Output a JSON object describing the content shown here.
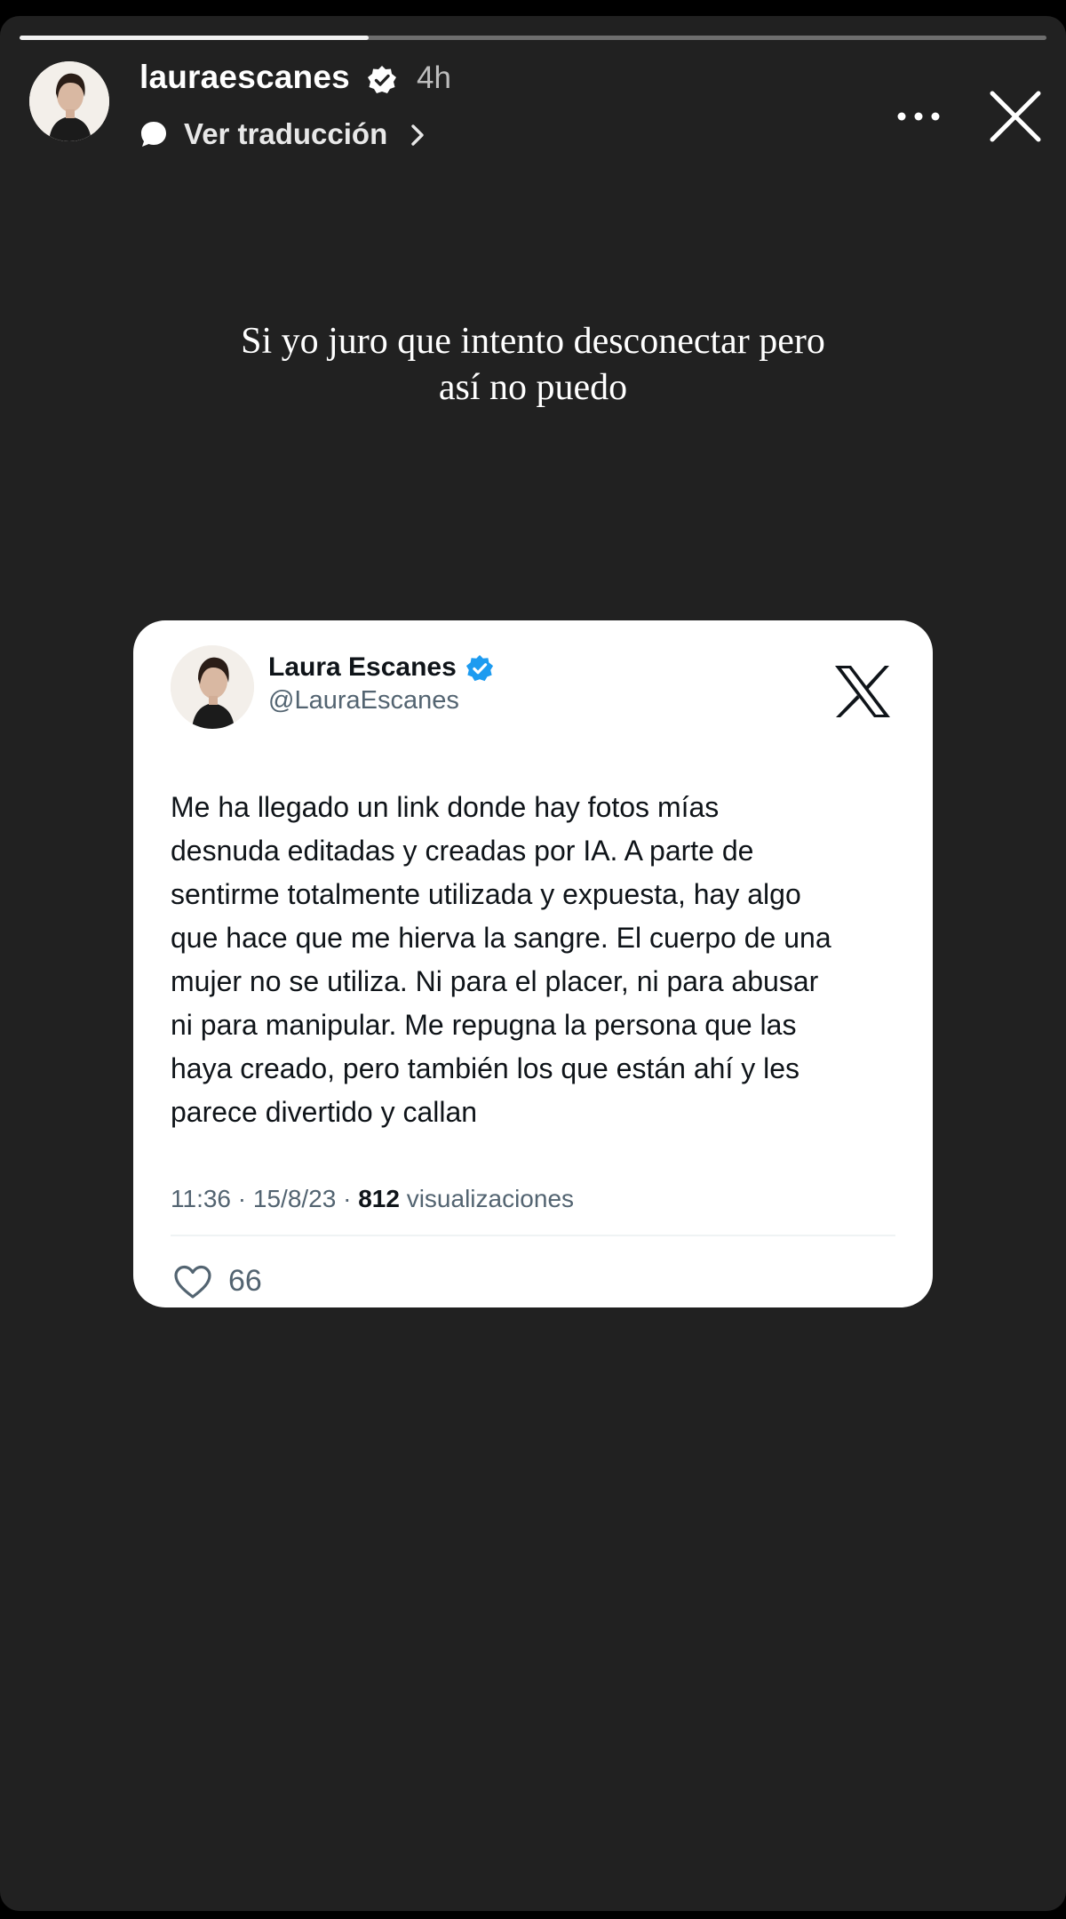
{
  "story": {
    "progress": 0.34,
    "username": "lauraescanes",
    "time_ago": "4h",
    "translate_label": "Ver traducción",
    "caption_lines": [
      "Si yo juro que intento desconectar pero",
      "así no puedo"
    ],
    "icons": {
      "verified": "verified-badge-icon",
      "translate": "speech-bubble-icon",
      "more": "more-options-icon",
      "close": "close-icon"
    }
  },
  "tweet": {
    "name": "Laura Escanes",
    "handle": "@LauraEscanes",
    "text_lines": [
      "Me ha llegado un link donde hay fotos mías",
      "desnuda editadas y creadas por IA. A parte de",
      "sentirme totalmente utilizada y expuesta, hay algo",
      "que hace que me hierva la sangre. El cuerpo de una",
      "mujer no se utiliza. Ni para el placer, ni para abusar",
      "ni para manipular. Me repugna la persona que las",
      "haya creado, pero también los que están ahí y les",
      "parece divertido y callan"
    ],
    "time": "11:36",
    "date": "15/8/23",
    "views_count": "812",
    "views_label": "visualizaciones",
    "likes": "66",
    "icons": {
      "platform_logo": "x-logo-icon",
      "like": "heart-icon"
    }
  },
  "colors": {
    "story_bg": "#212121",
    "verified_blue": "#1d9bf0",
    "tweet_text": "#0f1419",
    "tweet_muted": "#536471"
  }
}
